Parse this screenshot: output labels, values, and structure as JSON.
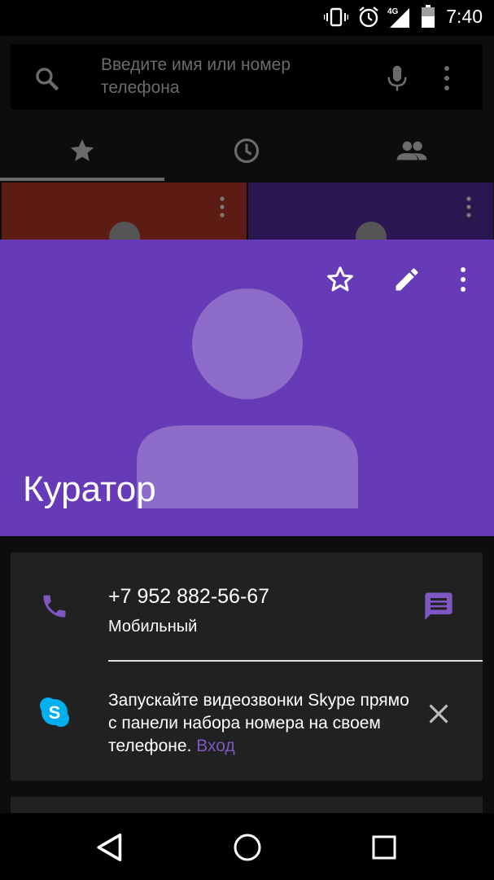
{
  "status_bar": {
    "network": "4G",
    "time": "7:40",
    "icons": [
      "vibrate-icon",
      "alarm-icon",
      "signal-icon",
      "battery-icon"
    ]
  },
  "search": {
    "placeholder": "Введите имя или номер телефона",
    "icons": [
      "search-icon",
      "mic-icon",
      "more-vert-icon"
    ]
  },
  "tabs": [
    {
      "icon": "star-icon",
      "selected": true
    },
    {
      "icon": "clock-icon",
      "selected": false
    },
    {
      "icon": "people-icon",
      "selected": false
    }
  ],
  "contact": {
    "name": "Куратор",
    "header_color": "#673ab7",
    "actions": [
      "star-outline-icon",
      "edit-icon",
      "more-vert-icon"
    ]
  },
  "phone": {
    "number": "+7 952 882-56-67",
    "type": "Мобильный"
  },
  "skype_promo": {
    "text": "Запускайте видеозвонки Skype прямо с панели набора номера на своем телефоне.",
    "link": "Вход"
  },
  "colors": {
    "accent": "#7e57c2",
    "card": "#212121"
  },
  "nav": [
    "back-icon",
    "home-icon",
    "recents-icon"
  ]
}
